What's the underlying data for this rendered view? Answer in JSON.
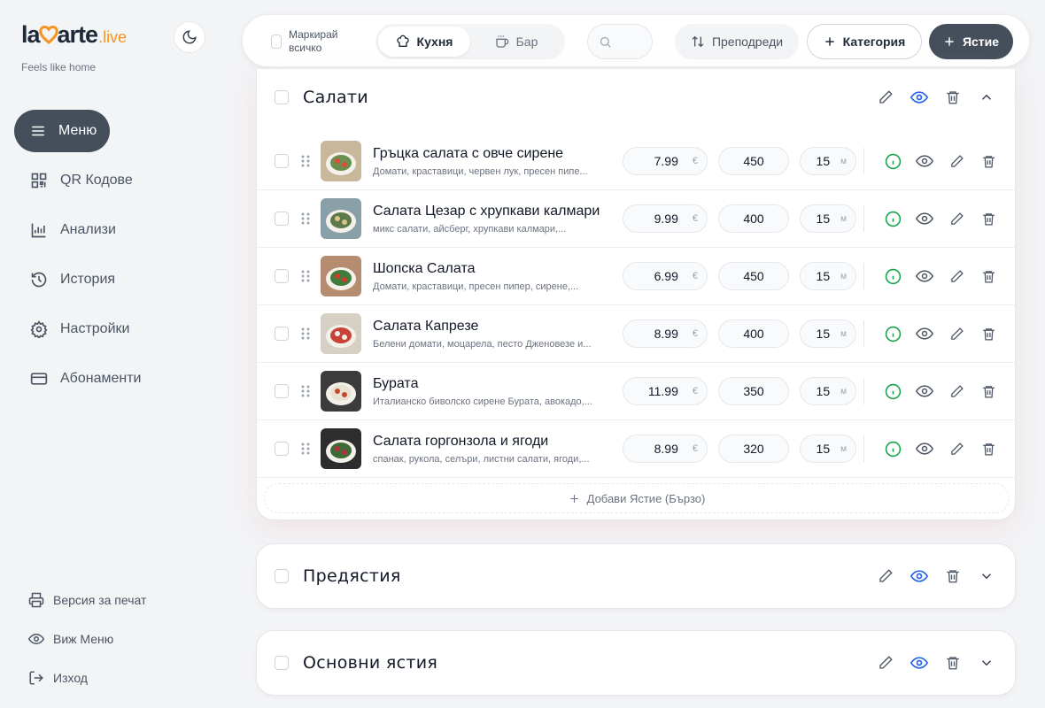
{
  "brand": {
    "name_prefix": "la",
    "name_suffix": "arte",
    "live": ".live",
    "tagline": "Feels like home"
  },
  "sidebar": {
    "items": [
      {
        "label": "Меню",
        "icon": "menu-icon",
        "active": true
      },
      {
        "label": "QR Кодове",
        "icon": "qr-icon"
      },
      {
        "label": "Анализи",
        "icon": "chart-icon"
      },
      {
        "label": "История",
        "icon": "history-icon"
      },
      {
        "label": "Настройки",
        "icon": "gear-icon"
      },
      {
        "label": "Абонаменти",
        "icon": "card-icon"
      }
    ],
    "bottom": [
      {
        "label": "Версия за печат",
        "icon": "printer-icon"
      },
      {
        "label": "Виж Меню",
        "icon": "eye-icon"
      },
      {
        "label": "Изход",
        "icon": "logout-icon"
      }
    ]
  },
  "toolbar": {
    "mark_all": "Маркирай всичко",
    "tabs": [
      {
        "label": "Кухня",
        "active": true
      },
      {
        "label": "Бар"
      }
    ],
    "search_placeholder": "",
    "reorder": "Преподреди",
    "category": "Категория",
    "dish": "Ястие"
  },
  "categories": [
    {
      "title": "Салати",
      "expanded": true,
      "quick_add": "Добави Ястие (Бързо)",
      "dishes": [
        {
          "name": "Гръцка салата с овче сирене",
          "desc": "Домати, краставици, червен лук, пресен пипе...",
          "price": "7.99",
          "weight": "450",
          "time": "15"
        },
        {
          "name": "Салата Цезар с хрупкави калмари",
          "desc": "микс салати, айсберг, хрупкави калмари,...",
          "price": "9.99",
          "weight": "400",
          "time": "15"
        },
        {
          "name": "Шопска Салата",
          "desc": "Домати, краставици, пресен пипер, сирене,...",
          "price": "6.99",
          "weight": "450",
          "time": "15"
        },
        {
          "name": "Салата Капрезе",
          "desc": "Белени домати, моцарела, песто Дженовезе и...",
          "price": "8.99",
          "weight": "400",
          "time": "15"
        },
        {
          "name": "Бурата",
          "desc": "Италианско биволско сирене Бурата, авокадо,...",
          "price": "11.99",
          "weight": "350",
          "time": "15"
        },
        {
          "name": "Салата горгонзола и ягоди",
          "desc": "спанак, рукола, селъри, листни салати, ягоди,...",
          "price": "8.99",
          "weight": "320",
          "time": "15"
        }
      ]
    },
    {
      "title": "Предястия",
      "expanded": false
    },
    {
      "title": "Основни ястия",
      "expanded": false
    }
  ],
  "units": {
    "currency": "€",
    "time": "м"
  },
  "colors": {
    "accent_dark": "#454f5b",
    "brand_orange": "#f7931e",
    "info_green": "#16a34a",
    "eye_blue": "#2563eb"
  }
}
